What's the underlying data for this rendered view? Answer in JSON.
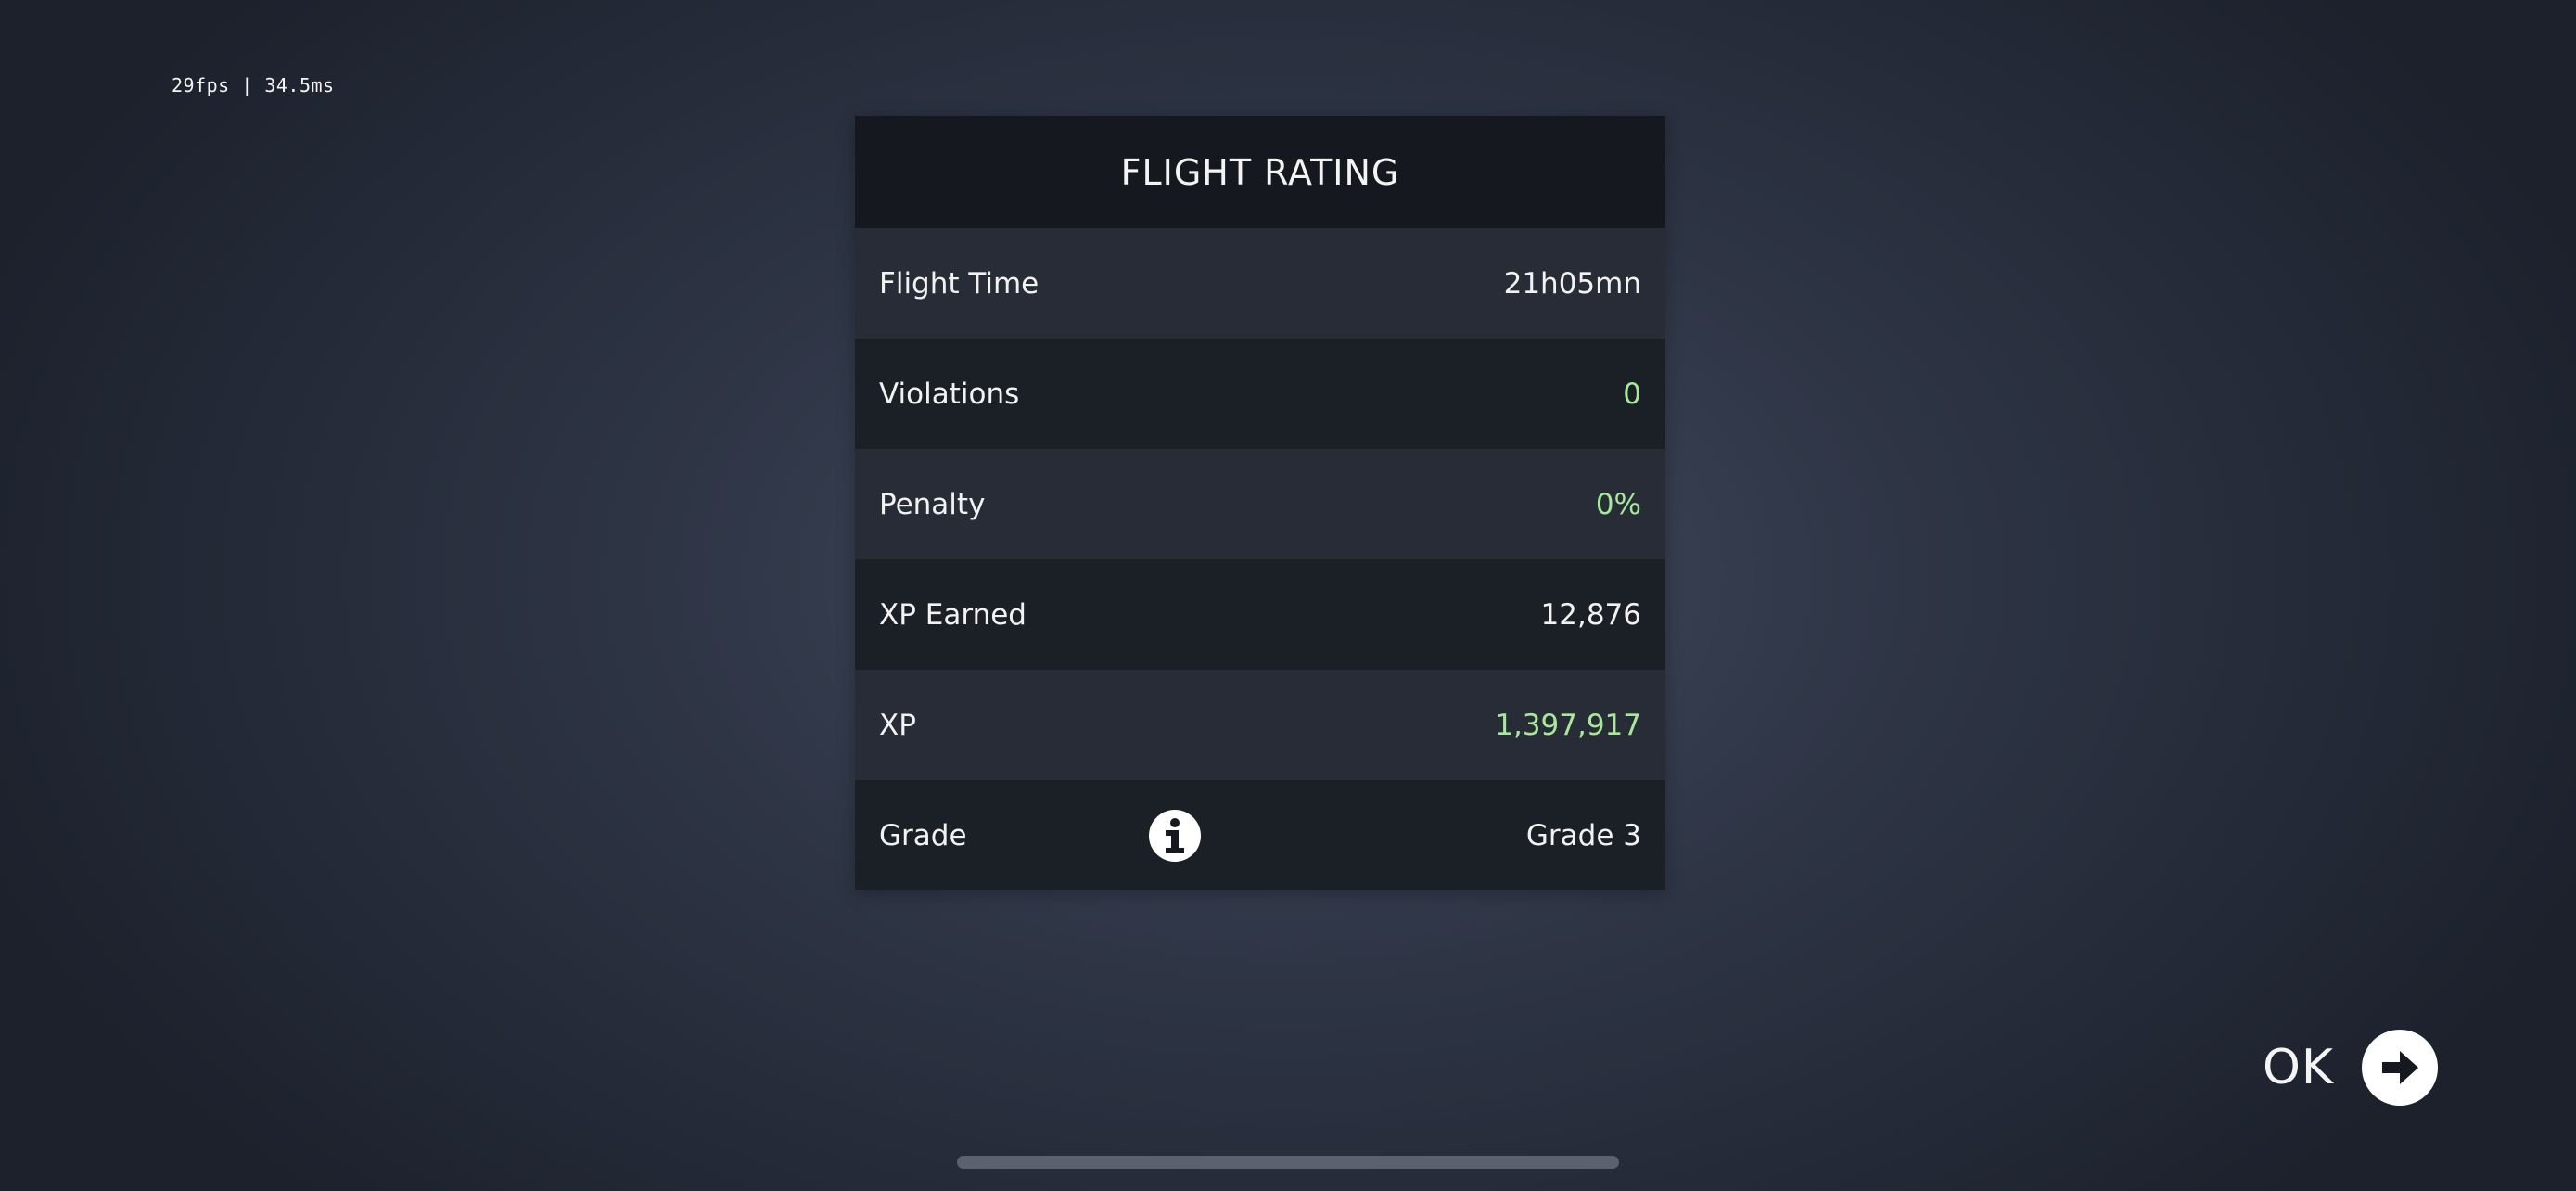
{
  "perf": {
    "text": "29fps | 34.5ms"
  },
  "panel": {
    "title": "FLIGHT RATING",
    "rows": [
      {
        "label": "Flight Time",
        "value": "21h05mn"
      },
      {
        "label": "Violations",
        "value": "0"
      },
      {
        "label": "Penalty",
        "value": "0%"
      },
      {
        "label": "XP Earned",
        "value": "12,876"
      },
      {
        "label": "XP",
        "value": "1,397,917"
      },
      {
        "label": "Grade",
        "value": "Grade 3"
      }
    ],
    "info_icon": "info-icon"
  },
  "ok_button": {
    "label": "OK",
    "icon": "arrow-right-circle-icon"
  },
  "colors": {
    "positive_value": "#a8e89a",
    "header_bg": "#15181e",
    "row_light": "#272c36",
    "row_dark": "#1b1f26"
  }
}
